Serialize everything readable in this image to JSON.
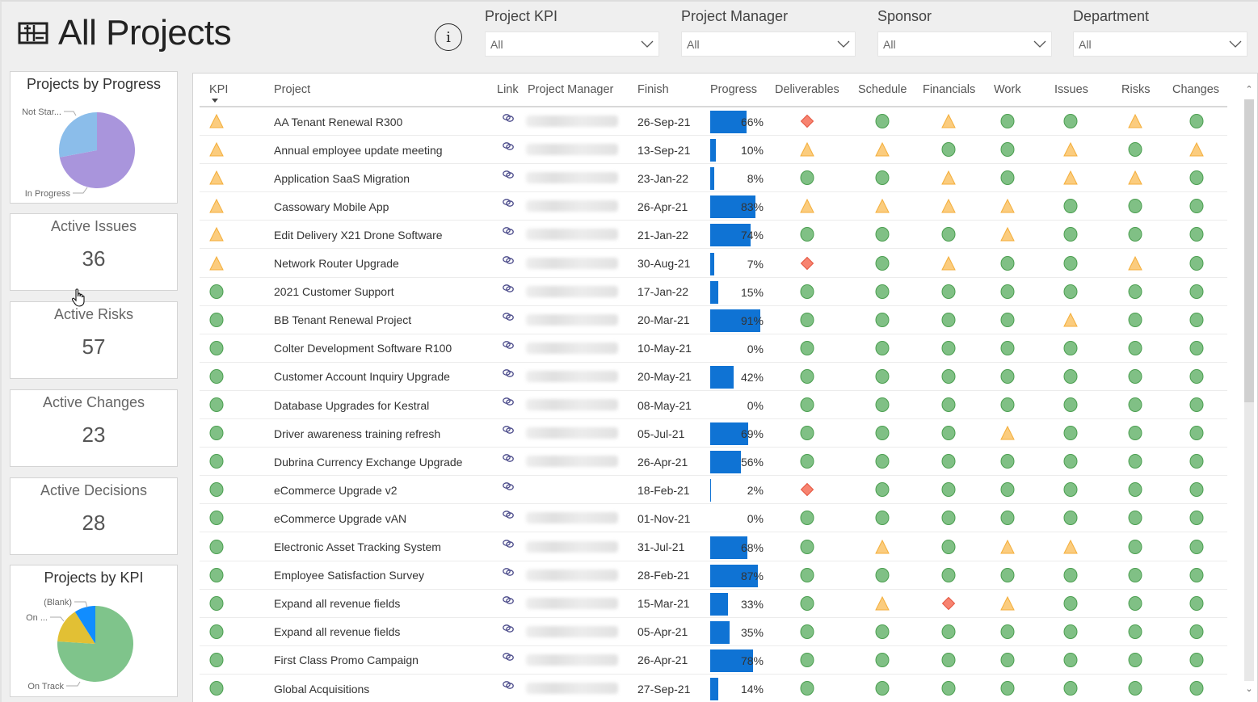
{
  "header": {
    "title": "All Projects",
    "title_icon": "roadmap-icon",
    "info_icon": "info-icon"
  },
  "filters": [
    {
      "label": "Project KPI",
      "value": "All"
    },
    {
      "label": "Project Manager",
      "value": "All"
    },
    {
      "label": "Sponsor",
      "value": "All"
    },
    {
      "label": "Department",
      "value": "All"
    }
  ],
  "cards": {
    "progress_pie": {
      "title": "Projects by Progress"
    },
    "issues": {
      "title": "Active Issues",
      "value": "36"
    },
    "risks": {
      "title": "Active Risks",
      "value": "57"
    },
    "changes": {
      "title": "Active Changes",
      "value": "23"
    },
    "decisions": {
      "title": "Active Decisions",
      "value": "28"
    },
    "kpi_pie": {
      "title": "Projects by KPI"
    }
  },
  "chart_data": [
    {
      "type": "pie",
      "title": "Projects by Progress",
      "categories": [
        "In Progress",
        "Not Started"
      ],
      "labels_shown": [
        "In Progress",
        "Not Star..."
      ],
      "values": [
        72,
        28
      ],
      "colors": [
        "#a995dc",
        "#8bbdea"
      ]
    },
    {
      "type": "pie",
      "title": "Projects by KPI",
      "categories": [
        "On Track",
        "On ...",
        "(Blank)"
      ],
      "labels_shown": [
        "On Track",
        "On ...",
        "(Blank)"
      ],
      "values": [
        76,
        15,
        9
      ],
      "colors": [
        "#7fc48b",
        "#e2c034",
        "#118dff"
      ]
    }
  ],
  "colors": {
    "green": "#80c085",
    "green_border": "#4a9e4f",
    "amber": "#fbcc7e",
    "amber_border": "#f4ae3a",
    "red": "#f78370",
    "red_border": "#e5553f",
    "progress_bar": "#0f73d4"
  },
  "table": {
    "columns": [
      "KPI",
      "Project",
      "Link",
      "Project Manager",
      "Finish",
      "Progress",
      "Deliverables",
      "Schedule",
      "Financials",
      "Work",
      "Issues",
      "Risks",
      "Changes"
    ],
    "sort_column": "KPI",
    "rows": [
      {
        "kpi": "amber",
        "project": "AA Tenant Renewal R300",
        "finish": "26-Sep-21",
        "progress": 66,
        "progress_label": "66%",
        "status": [
          "red",
          "green",
          "amber",
          "green",
          "green",
          "amber",
          "green"
        ]
      },
      {
        "kpi": "amber",
        "project": "Annual employee update meeting",
        "finish": "13-Sep-21",
        "progress": 10,
        "progress_label": "10%",
        "status": [
          "amber",
          "amber",
          "green",
          "green",
          "amber",
          "green",
          "amber"
        ]
      },
      {
        "kpi": "amber",
        "project": "Application SaaS Migration",
        "finish": "23-Jan-22",
        "progress": 8,
        "progress_label": "8%",
        "status": [
          "green",
          "green",
          "amber",
          "green",
          "amber",
          "amber",
          "green"
        ]
      },
      {
        "kpi": "amber",
        "project": "Cassowary Mobile App",
        "finish": "26-Apr-21",
        "progress": 83,
        "progress_label": "83%",
        "status": [
          "amber",
          "amber",
          "amber",
          "amber",
          "green",
          "green",
          "green"
        ]
      },
      {
        "kpi": "amber",
        "project": "Edit Delivery X21 Drone Software",
        "finish": "21-Jan-22",
        "progress": 74,
        "progress_label": "74%",
        "status": [
          "green",
          "green",
          "green",
          "amber",
          "green",
          "green",
          "green"
        ]
      },
      {
        "kpi": "amber",
        "project": "Network Router Upgrade",
        "finish": "30-Aug-21",
        "progress": 7,
        "progress_label": "7%",
        "status": [
          "red",
          "green",
          "amber",
          "green",
          "green",
          "amber",
          "green"
        ]
      },
      {
        "kpi": "green",
        "project": "2021 Customer Support",
        "finish": "17-Jan-22",
        "progress": 15,
        "progress_label": "15%",
        "status": [
          "green",
          "green",
          "green",
          "green",
          "green",
          "green",
          "green"
        ]
      },
      {
        "kpi": "green",
        "project": "BB Tenant Renewal Project",
        "finish": "20-Mar-21",
        "progress": 91,
        "progress_label": "91%",
        "status": [
          "green",
          "green",
          "green",
          "green",
          "amber",
          "green",
          "green"
        ]
      },
      {
        "kpi": "green",
        "project": "Colter Development Software R100",
        "finish": "10-May-21",
        "progress": 0,
        "progress_label": "0%",
        "status": [
          "green",
          "green",
          "green",
          "green",
          "green",
          "green",
          "green"
        ]
      },
      {
        "kpi": "green",
        "project": "Customer Account Inquiry Upgrade",
        "finish": "20-May-21",
        "progress": 42,
        "progress_label": "42%",
        "status": [
          "green",
          "green",
          "green",
          "green",
          "green",
          "green",
          "green"
        ]
      },
      {
        "kpi": "green",
        "project": "Database Upgrades for Kestral",
        "finish": "08-May-21",
        "progress": 0,
        "progress_label": "0%",
        "status": [
          "green",
          "green",
          "green",
          "green",
          "green",
          "green",
          "green"
        ]
      },
      {
        "kpi": "green",
        "project": "Driver awareness training refresh",
        "finish": "05-Jul-21",
        "progress": 69,
        "progress_label": "69%",
        "status": [
          "green",
          "green",
          "green",
          "amber",
          "green",
          "green",
          "green"
        ]
      },
      {
        "kpi": "green",
        "project": "Dubrina Currency Exchange Upgrade",
        "finish": "26-Apr-21",
        "progress": 56,
        "progress_label": "56%",
        "status": [
          "green",
          "green",
          "green",
          "green",
          "green",
          "green",
          "green"
        ]
      },
      {
        "kpi": "green",
        "project": "eCommerce Upgrade v2",
        "finish": "18-Feb-21",
        "progress": 2,
        "progress_label": "2%",
        "no_manager": true,
        "status": [
          "red",
          "green",
          "green",
          "green",
          "green",
          "green",
          "green"
        ]
      },
      {
        "kpi": "green",
        "project": "eCommerce Upgrade vAN",
        "finish": "01-Nov-21",
        "progress": 0,
        "progress_label": "0%",
        "status": [
          "green",
          "green",
          "green",
          "green",
          "green",
          "green",
          "green"
        ]
      },
      {
        "kpi": "green",
        "project": "Electronic Asset Tracking System",
        "finish": "31-Jul-21",
        "progress": 68,
        "progress_label": "68%",
        "status": [
          "green",
          "amber",
          "green",
          "amber",
          "amber",
          "green",
          "green"
        ]
      },
      {
        "kpi": "green",
        "project": "Employee Satisfaction Survey",
        "finish": "28-Feb-21",
        "progress": 87,
        "progress_label": "87%",
        "status": [
          "green",
          "green",
          "green",
          "green",
          "green",
          "green",
          "green"
        ]
      },
      {
        "kpi": "green",
        "project": "Expand all revenue fields",
        "finish": "15-Mar-21",
        "progress": 33,
        "progress_label": "33%",
        "status": [
          "green",
          "amber",
          "red",
          "amber",
          "green",
          "green",
          "green"
        ]
      },
      {
        "kpi": "green",
        "project": "Expand all revenue fields",
        "finish": "05-Apr-21",
        "progress": 35,
        "progress_label": "35%",
        "status": [
          "green",
          "green",
          "green",
          "green",
          "green",
          "green",
          "green"
        ]
      },
      {
        "kpi": "green",
        "project": "First Class Promo Campaign",
        "finish": "26-Apr-21",
        "progress": 78,
        "progress_label": "78%",
        "status": [
          "green",
          "green",
          "green",
          "green",
          "green",
          "green",
          "green"
        ]
      },
      {
        "kpi": "green",
        "project": "Global Acquisitions",
        "finish": "27-Sep-21",
        "progress": 14,
        "progress_label": "14%",
        "status": [
          "green",
          "green",
          "green",
          "green",
          "green",
          "green",
          "green"
        ]
      }
    ]
  }
}
